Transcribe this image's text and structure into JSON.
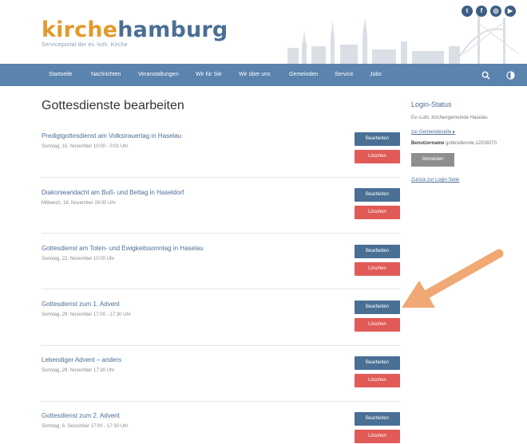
{
  "header": {
    "logo_kirche": "kirche",
    "logo_hamburg": "hamburg",
    "logo_subtitle": "Serviceportal der ev.-luth. Kirche",
    "social_icons": [
      "twitter-icon",
      "facebook-icon",
      "instagram-icon",
      "youtube-icon"
    ]
  },
  "nav": {
    "items": [
      "Startseite",
      "Nachrichten",
      "Veranstaltungen",
      "Wir für Sie",
      "Wir über uns",
      "Gemeinden",
      "Service",
      "Jobs"
    ],
    "search_icon": "search-icon",
    "contrast_icon": "contrast-icon"
  },
  "main": {
    "title": "Gottesdienste bearbeiten",
    "edit_label": "Bearbeiten",
    "delete_label": "Löschen",
    "entries": [
      {
        "title": "Predigtgottesdienst am Volkstrauertag in Haselau",
        "date": "Sonntag, 15. November 10:00 - 0:01 Uhr"
      },
      {
        "title": "Diakonieandacht am Buß- und Bettag in Haseldorf",
        "date": "Mittwoch, 18. November 19:00 Uhr"
      },
      {
        "title": "Gottesdienst am Toten- und Ewigkeitssonntag in Haselau",
        "date": "Sonntag, 22. November 10:00 Uhr"
      },
      {
        "title": "Gottesdienst zum 1. Advent",
        "date": "Sonntag, 29. November 17:00 - 17:30 Uhr"
      },
      {
        "title": "Lebendiger Advent – anders",
        "date": "Sonntag, 29. November 17:30 Uhr"
      },
      {
        "title": "Gottesdienst zum 2. Advent",
        "date": "Sonntag, 6. Dezember 17:00 - 17:30 Uhr"
      }
    ]
  },
  "sidebar": {
    "title": "Login-Status",
    "org": "Ev.-Luth. Kirchengemeinde Haselau",
    "community_link": "zur Gemeindeseite",
    "username_label": "Benutzername",
    "username_value": "gottesdienste.12208370",
    "logout_label": "Abmelden",
    "back_link": "Zurück zur Login-Seite"
  },
  "colors": {
    "brand_orange": "#e39a2d",
    "brand_blue": "#4a6f95",
    "nav_blue": "#5a83ad",
    "delete_red": "#e05a57",
    "arrow_orange": "#f0a874"
  }
}
